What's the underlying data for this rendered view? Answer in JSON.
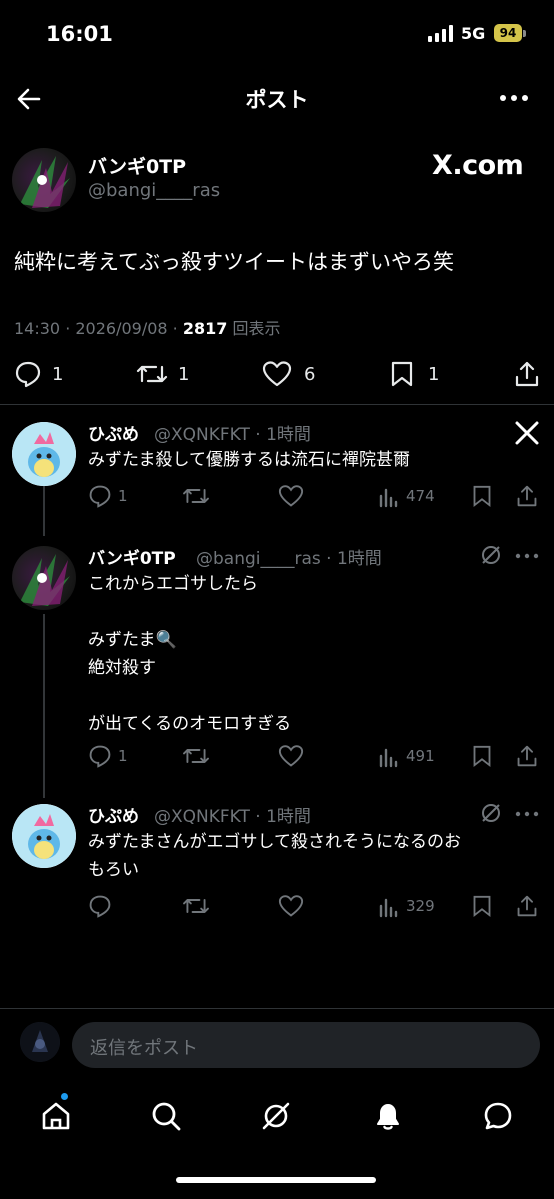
{
  "status_bar": {
    "time": "16:01",
    "network": "5G",
    "battery": "94"
  },
  "header": {
    "title": "ポスト"
  },
  "main_post": {
    "display_name": "バンギ0TP",
    "handle": "@bangi____ras",
    "brand_text": "X.com",
    "text": "純粋に考えてぶっ殺すツイートはまずいやろ笑",
    "timestamp": "14:30 · 2026/09/08 · ",
    "views": "2817",
    "views_label": " 回表示",
    "actions": {
      "replies": "1",
      "reposts": "1",
      "likes": "6",
      "bookmarks": "1"
    }
  },
  "replies": [
    {
      "display_name": "ひぷめ",
      "handle_time": "@XQNKFKT · 1時間",
      "text": "みずたま殺して優勝するは流石に禪院甚爾",
      "replies": "1",
      "views": "474"
    },
    {
      "display_name": "バンギ0TP",
      "handle_time": "@bangi____ras · 1時間",
      "text": "これからエゴサしたら\n\nみずたま🔍\n絶対殺す\n\nが出てくるのオモロすぎる",
      "replies": "1",
      "views": "491"
    },
    {
      "display_name": "ひぷめ",
      "handle_time": "@XQNKFKT · 1時間",
      "text": "みずたまさんがエゴサして殺されそうになるのお\nもろい",
      "replies": "",
      "views": "329"
    }
  ],
  "composer": {
    "placeholder": "返信をポスト"
  },
  "colors": {
    "background": "#000000",
    "muted": "#71767b",
    "accent": "#1d9bf0"
  }
}
